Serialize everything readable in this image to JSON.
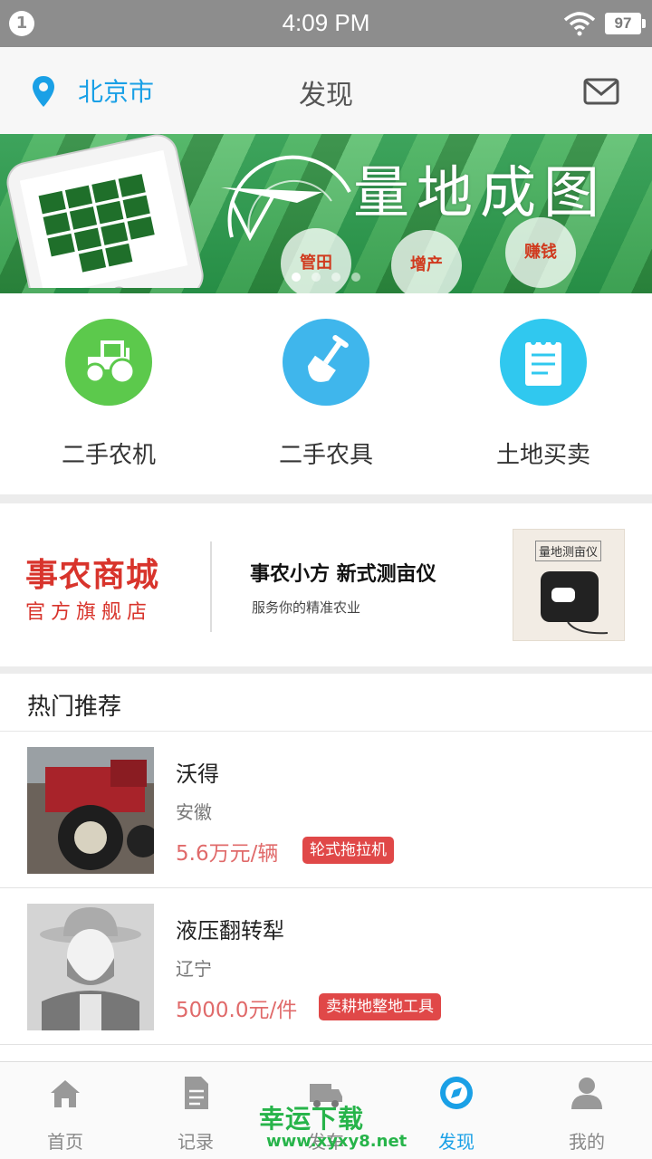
{
  "status_bar": {
    "notification_count": "1",
    "time": "4:09 PM",
    "battery": "97"
  },
  "header": {
    "city": "北京市",
    "title": "发现"
  },
  "banner": {
    "headline": "量地成图",
    "pills": [
      "管田",
      "增产",
      "赚钱"
    ]
  },
  "categories": [
    {
      "label": "二手农机",
      "icon": "tractor-icon",
      "color": "#5cc94c"
    },
    {
      "label": "二手农具",
      "icon": "shovel-icon",
      "color": "#3fb6ec"
    },
    {
      "label": "土地买卖",
      "icon": "notepad-icon",
      "color": "#30c8ef"
    }
  ],
  "mall": {
    "name": "事农商城",
    "subtitle": "官方旗舰店",
    "promo_title": "事农小方  新式测亩仪",
    "promo_sub": "服务你的精准农业",
    "product_label": "量地测亩仪"
  },
  "hot": {
    "title": "热门推荐",
    "items": [
      {
        "name": "沃得",
        "region": "安徽",
        "price": "5.6万元/辆",
        "tag": "轮式拖拉机"
      },
      {
        "name": "液压翻转犁",
        "region": "辽宁",
        "price": "5000.0元/件",
        "tag": "卖耕地整地工具"
      }
    ]
  },
  "tabbar": {
    "tabs": [
      {
        "label": "首页",
        "icon": "home-icon"
      },
      {
        "label": "记录",
        "icon": "document-icon"
      },
      {
        "label": "发车",
        "icon": "truck-icon"
      },
      {
        "label": "发现",
        "icon": "compass-icon",
        "active": true
      },
      {
        "label": "我的",
        "icon": "user-icon"
      }
    ]
  },
  "watermark": {
    "line1": "幸运下载",
    "line2": "www.xyxy8.net"
  },
  "colors": {
    "accent": "#1aa0e6",
    "brand_red": "#d8342c",
    "tag_red": "#e04848"
  }
}
